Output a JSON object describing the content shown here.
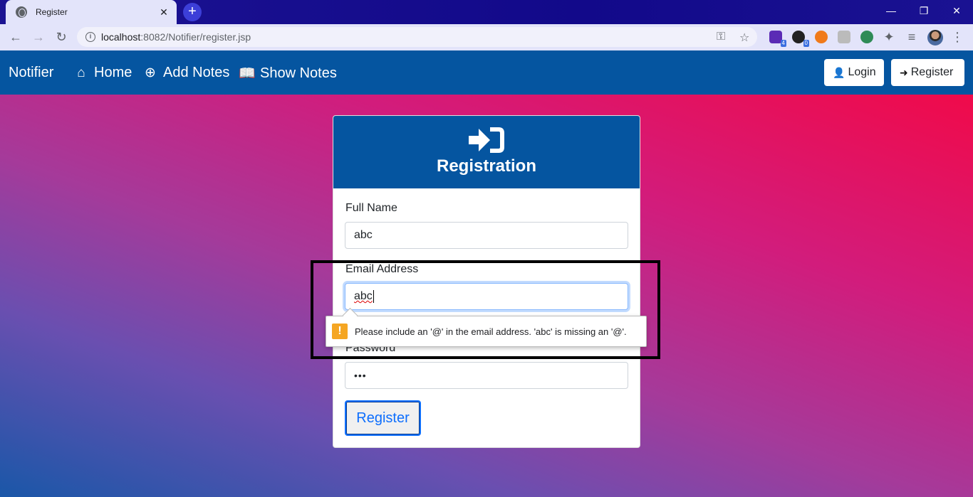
{
  "browser": {
    "tab_title": "Register",
    "tab_close": "✕",
    "new_tab": "+",
    "url_host": "localhost",
    "url_rest": ":8082/Notifier/register.jsp",
    "window_controls": [
      "—",
      "❐",
      "✕"
    ],
    "extension_badges": [
      "4",
      "0"
    ]
  },
  "navbar": {
    "brand": "Notifier",
    "links": [
      {
        "label": "Home",
        "icon": "home-icon"
      },
      {
        "label": "Add Notes",
        "icon": "plus-circle-icon"
      },
      {
        "label": "Show Notes",
        "icon": "book-icon"
      }
    ],
    "login_label": "Login",
    "register_label": "Register"
  },
  "form": {
    "title": "Registration",
    "full_name_label": "Full Name",
    "full_name_value": "abc",
    "email_label": "Email Address",
    "email_value": "abc",
    "password_label": "Password",
    "password_value": "•••",
    "submit_label": "Register"
  },
  "validation": {
    "message": "Please include an '@' in the email address. 'abc' is missing an '@'."
  },
  "colors": {
    "navbar": "#0555a0",
    "card_header": "#0555a0",
    "primary": "#0d6efd",
    "warning": "#f5a623"
  }
}
